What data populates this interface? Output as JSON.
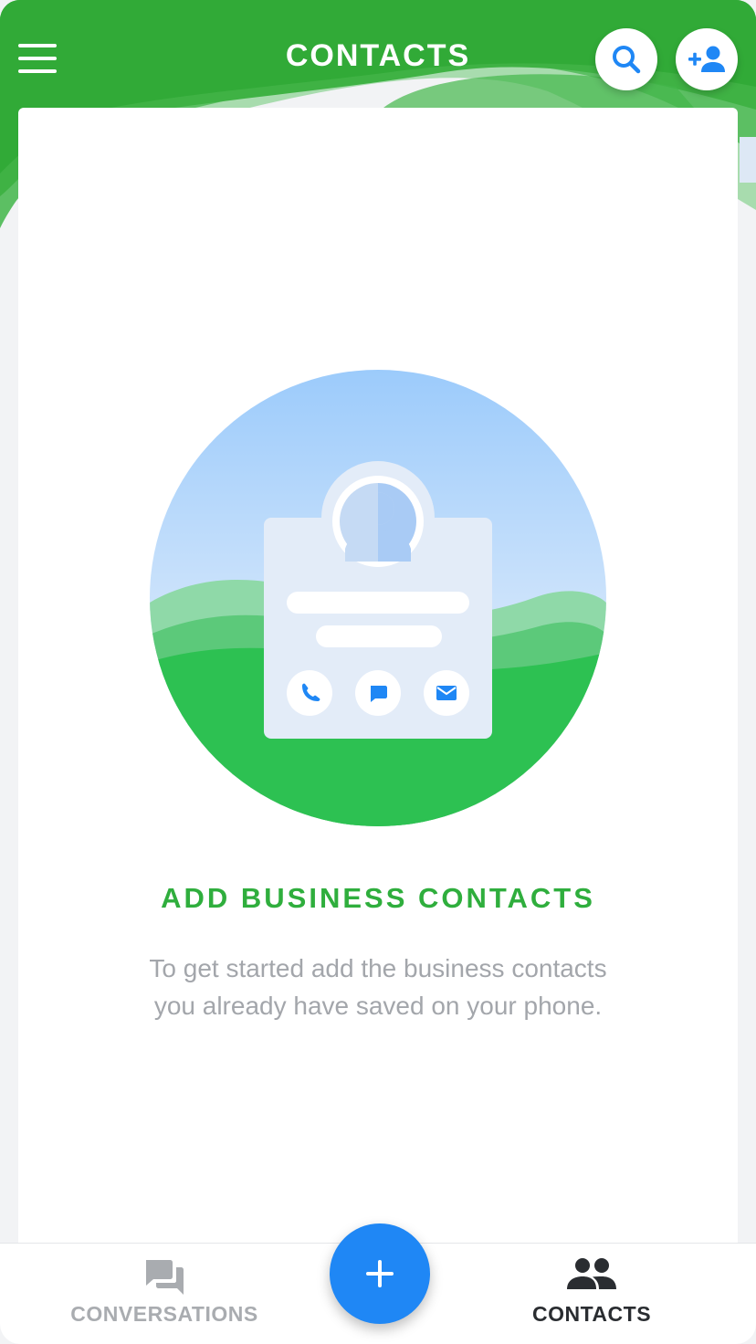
{
  "header": {
    "title": "CONTACTS",
    "menu_icon": "hamburger-menu-icon",
    "search_icon": "search-icon",
    "add_contact_icon": "add-person-icon"
  },
  "empty_state": {
    "illustration": "contact-card-illustration",
    "title": "ADD BUSINESS CONTACTS",
    "description_line1": "To get started add the business contacts",
    "description_line2": "you already have saved on your phone."
  },
  "bottom_nav": {
    "items": [
      {
        "label": "CONVERSATIONS",
        "icon": "conversations-icon",
        "active": false
      },
      {
        "label": "CONTACTS",
        "icon": "people-icon",
        "active": true
      }
    ],
    "fab_icon": "plus-icon"
  },
  "colors": {
    "brand_green": "#2fb23e",
    "accent_blue": "#1f87f5",
    "title_green": "#2fae3d",
    "muted_text": "#a3a6ab"
  }
}
